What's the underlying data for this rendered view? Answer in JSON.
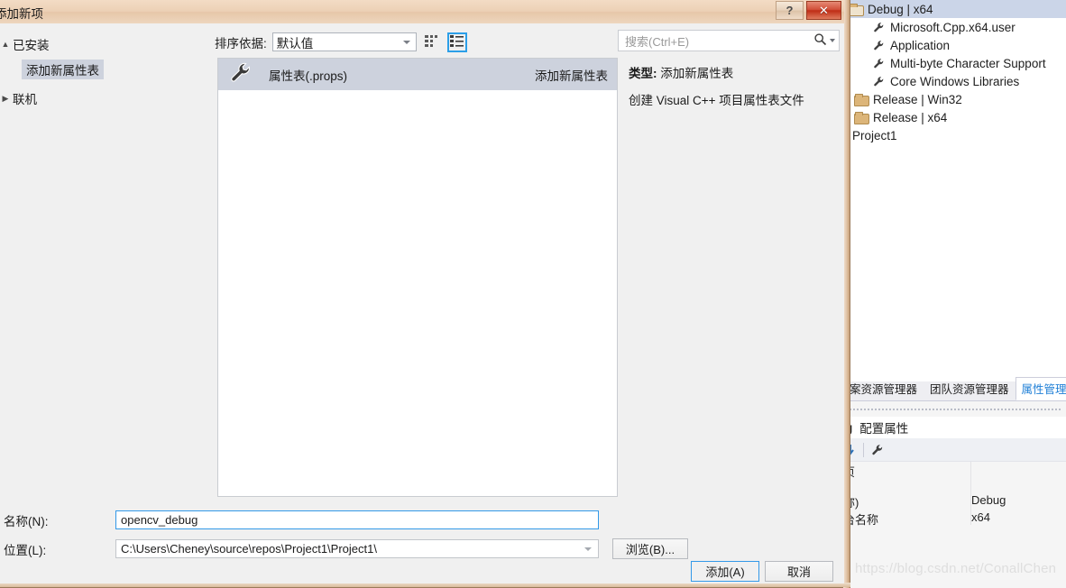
{
  "dialog": {
    "title": "添加新项",
    "window_controls": {
      "help": "?",
      "close": "✕"
    },
    "left_tree": {
      "installed_label": "已安装",
      "installed_child": "添加新属性表",
      "online_label": "联机"
    },
    "toolbar": {
      "sort_label": "排序依据:",
      "sort_value": "默认值",
      "view_small_icons_icon": "small-icons-view-icon",
      "view_list_icon": "list-view-icon"
    },
    "list": {
      "items": [
        {
          "icon": "wrench-icon",
          "name": "属性表(.props)",
          "source": "添加新属性表"
        }
      ]
    },
    "search": {
      "placeholder": "搜索(Ctrl+E)",
      "icon": "search-icon"
    },
    "details": {
      "type_label": "类型:",
      "type_value": "添加新属性表",
      "description": "创建 Visual C++ 项目属性表文件"
    },
    "footer": {
      "name_label": "名称(N):",
      "name_value": "opencv_debug",
      "location_label": "位置(L):",
      "location_value": "C:\\Users\\Cheney\\source\\repos\\Project1\\Project1\\",
      "browse_button": "浏览(B)...",
      "add_button": "添加(A)",
      "cancel_button": "取消"
    }
  },
  "ide": {
    "tree": [
      {
        "label": "Debug | x64",
        "icon": "folder-open-icon",
        "indent": 0,
        "selected": true
      },
      {
        "label": "Microsoft.Cpp.x64.user",
        "icon": "wrench-icon",
        "indent": 2,
        "selected": false
      },
      {
        "label": "Application",
        "icon": "wrench-icon",
        "indent": 2,
        "selected": false
      },
      {
        "label": "Multi-byte Character Support",
        "icon": "wrench-icon",
        "indent": 2,
        "selected": false
      },
      {
        "label": "Core Windows Libraries",
        "icon": "wrench-icon",
        "indent": 2,
        "selected": false
      },
      {
        "label": "Release | Win32",
        "icon": "folder-icon",
        "indent": 1,
        "selected": false
      },
      {
        "label": "Release | x64",
        "icon": "folder-icon",
        "indent": 1,
        "selected": false
      }
    ],
    "project_label": "Project1",
    "tabs": [
      {
        "label": "案资源管理器",
        "active": false
      },
      {
        "label": "团队资源管理器",
        "active": false
      },
      {
        "label": "属性管理器",
        "active": true
      }
    ],
    "config_header_fragment": "g",
    "config_header_text": "配置属性",
    "toolbar_icons": [
      "sort-down-icon",
      "wrench-icon"
    ],
    "grid_rows": [
      {
        "key": "页",
        "value": ""
      },
      {
        "key": "称)",
        "value": "Debug"
      },
      {
        "key": "台名称",
        "value": "x64"
      }
    ]
  },
  "watermark": "https://blog.csdn.net/ConallChen"
}
